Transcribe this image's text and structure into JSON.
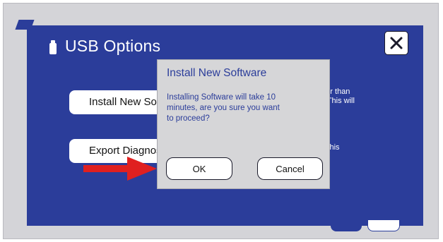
{
  "usb_dialog": {
    "title": "USB Options",
    "install_button_label": "Install New Software",
    "export_button_label": "Export Diagnostics",
    "install_description": "is newer than\nnning. This will",
    "export_description": "and\ndrive. This\n."
  },
  "modal": {
    "title": "Install New Software",
    "message": "Installing Software will take 10 minutes, are you sure you want to proceed?",
    "ok_label": "OK",
    "cancel_label": "Cancel"
  },
  "colors": {
    "panel_blue": "#2b3d9a",
    "modal_gray": "#d6d6d8",
    "annotation_arrow": "#e02020"
  },
  "icons": {
    "usb": "usb-drive-icon",
    "close": "close-icon",
    "annotation": "red-arrow-annotation"
  }
}
